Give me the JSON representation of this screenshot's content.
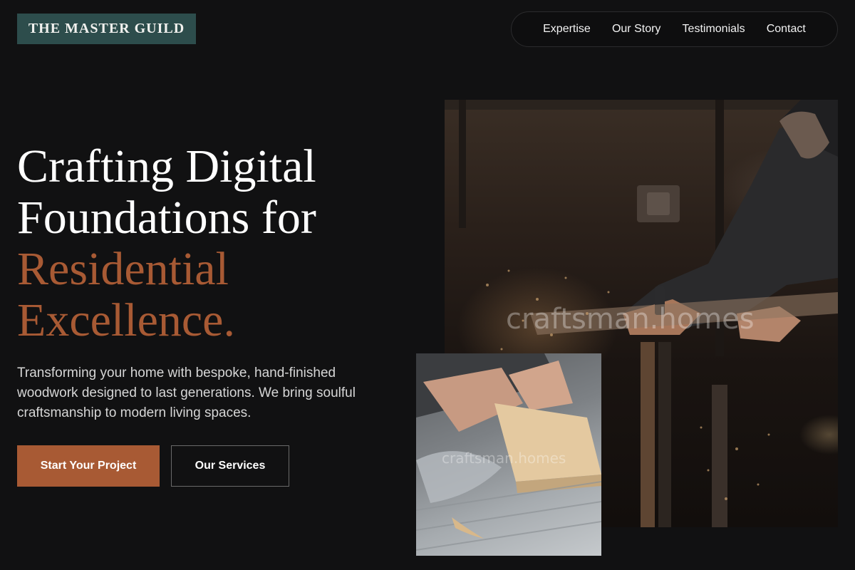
{
  "brand": {
    "logo_text": "THE MASTER GUILD"
  },
  "nav": {
    "items": [
      {
        "label": "Expertise"
      },
      {
        "label": "Our Story"
      },
      {
        "label": "Testimonials"
      },
      {
        "label": "Contact"
      }
    ]
  },
  "hero": {
    "headline": {
      "line1": "Crafting Digital",
      "line2": "Foundations for",
      "accent_line1": "Residential",
      "accent_line2": "Excellence."
    },
    "subtext": "Transforming your home with bespoke, hand-finished woodwork designed to last generations. We bring soulful craftsmanship to modern living spaces.",
    "primary_cta": "Start Your Project",
    "secondary_cta": "Our Services"
  },
  "images": {
    "main": {
      "subject": "craftsman cutting wood with a saw, sawdust flying",
      "watermark": "craftsman.homes"
    },
    "secondary": {
      "subject": "hands pushing a wood block across a table saw",
      "watermark": "craftsman.homes"
    }
  },
  "colors": {
    "background": "#111112",
    "logo_bg": "#2d4d4c",
    "accent": "#a85a34",
    "text": "#ffffff",
    "muted_text": "#d6d6d6"
  }
}
